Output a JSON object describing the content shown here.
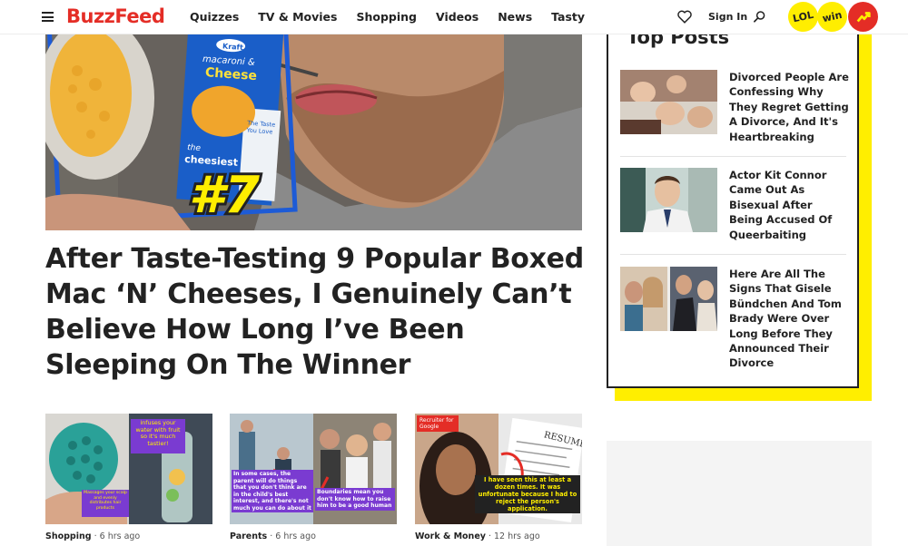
{
  "header": {
    "logo": "BuzzFeed",
    "nav": [
      "Quizzes",
      "TV & Movies",
      "Shopping",
      "Videos",
      "News",
      "Tasty"
    ],
    "sign_in": "Sign In",
    "badges": {
      "lol": "LOL",
      "win": "win"
    },
    "icons": [
      "menu-icon",
      "heart-icon",
      "search-icon",
      "trending-icon"
    ]
  },
  "hero": {
    "box_brand": "Kraft",
    "box_product": "macaroni & Cheese",
    "box_tagline": "the cheesiest",
    "box_side": "The Taste You Love",
    "rank": "#7"
  },
  "article": {
    "headline": "After Taste-Testing 9 Popular Boxed Mac ‘N’ Cheeses, I Genuinely Can’t Believe How Long I’ve Been Sleeping On The Winner"
  },
  "cards": [
    {
      "category": "Shopping",
      "time": "6 hrs ago",
      "caption_top": "infuses your water with fruit so it's much tastier!",
      "caption_bottom": "Massages your scalp and evenly distributes hair products"
    },
    {
      "category": "Parents",
      "time": "6 hrs ago",
      "caption_left": "In some cases, the parent will do things that you don't think are in the child's best interest, and there's not much you can do about it",
      "caption_right": "Boundaries mean you don't know how to raise him to be a good human"
    },
    {
      "category": "Work & Money",
      "time": "12 hrs ago",
      "tag": "Recruiter for Google",
      "doc_title": "RESUME",
      "caption": "I have seen this at least a dozen times. It was unfortunate because I had to reject the person's application."
    }
  ],
  "top_posts": {
    "title": "Top Posts",
    "items": [
      {
        "title": "Divorced People Are Confessing Why They Regret Getting A Divorce, And It's Heartbreaking"
      },
      {
        "title": "Actor Kit Connor Came Out As Bisexual After Being Accused Of Queerbaiting"
      },
      {
        "title": "Here Are All The Signs That Gisele Bündchen And Tom Brady Were Over Long Before They Announced Their Divorce"
      }
    ]
  },
  "colors": {
    "brand": "#e42d26",
    "highlight": "#ffee00",
    "text": "#222222"
  }
}
